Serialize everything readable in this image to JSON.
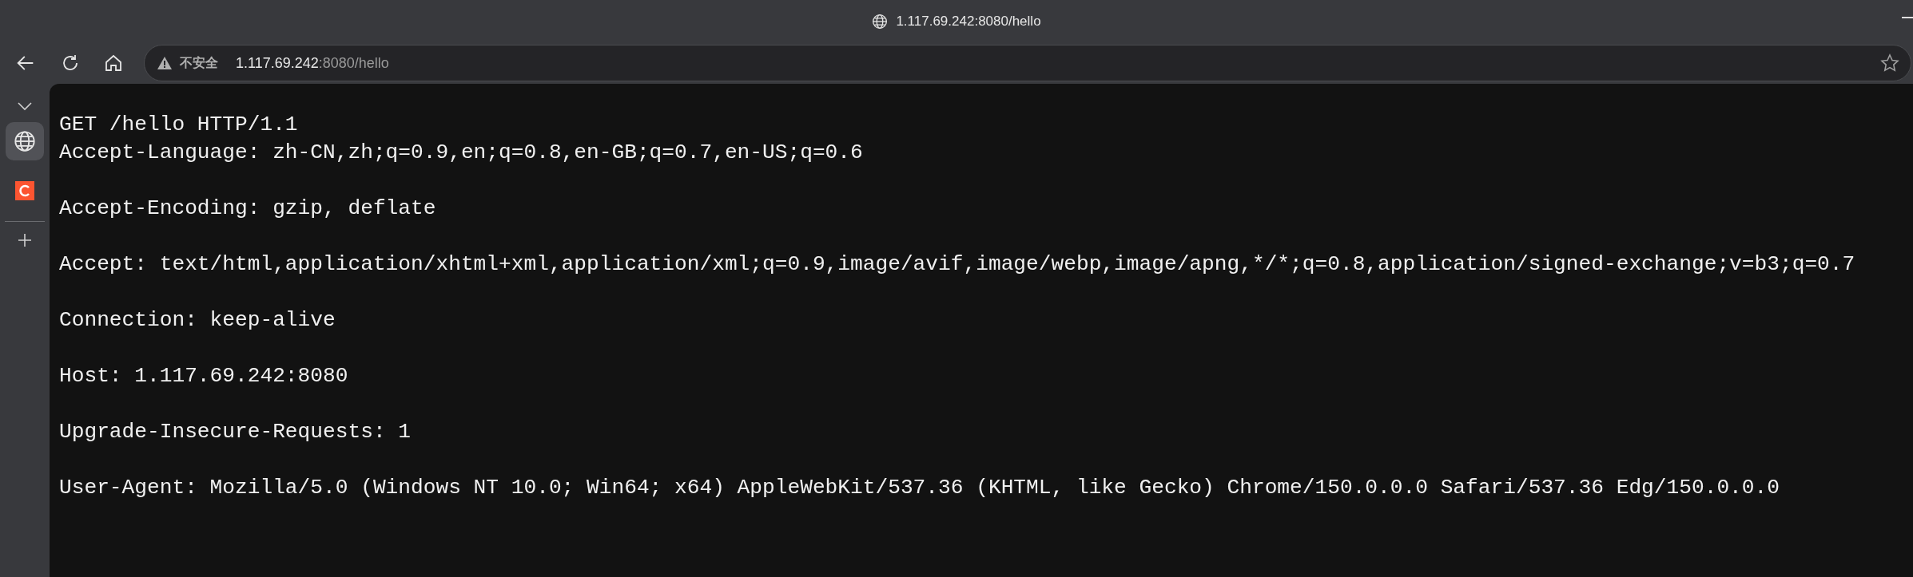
{
  "window": {
    "title": "1.117.69.242:8080/hello"
  },
  "address_bar": {
    "security_label": "不安全",
    "host": "1.117.69.242",
    "path": ":8080/hello"
  },
  "page": {
    "request_line": "GET /hello HTTP/1.1",
    "headers": [
      "Accept-Language: zh-CN,zh;q=0.9,en;q=0.8,en-GB;q=0.7,en-US;q=0.6",
      "Accept-Encoding: gzip, deflate",
      "Accept: text/html,application/xhtml+xml,application/xml;q=0.9,image/avif,image/webp,image/apng,*/*;q=0.8,application/signed-exchange;v=b3;q=0.7",
      "Connection: keep-alive",
      "Host: 1.117.69.242:8080",
      "Upgrade-Insecure-Requests: 1",
      "User-Agent: Mozilla/5.0 (Windows NT 10.0; Win64; x64) AppleWebKit/537.36 (KHTML, like Gecko) Chrome/150.0.0.0 Safari/537.36 Edg/150.0.0.0"
    ]
  },
  "sidebar": {
    "tabs": [
      {
        "kind": "globe",
        "selected": true
      },
      {
        "kind": "csdn",
        "selected": false
      }
    ]
  }
}
